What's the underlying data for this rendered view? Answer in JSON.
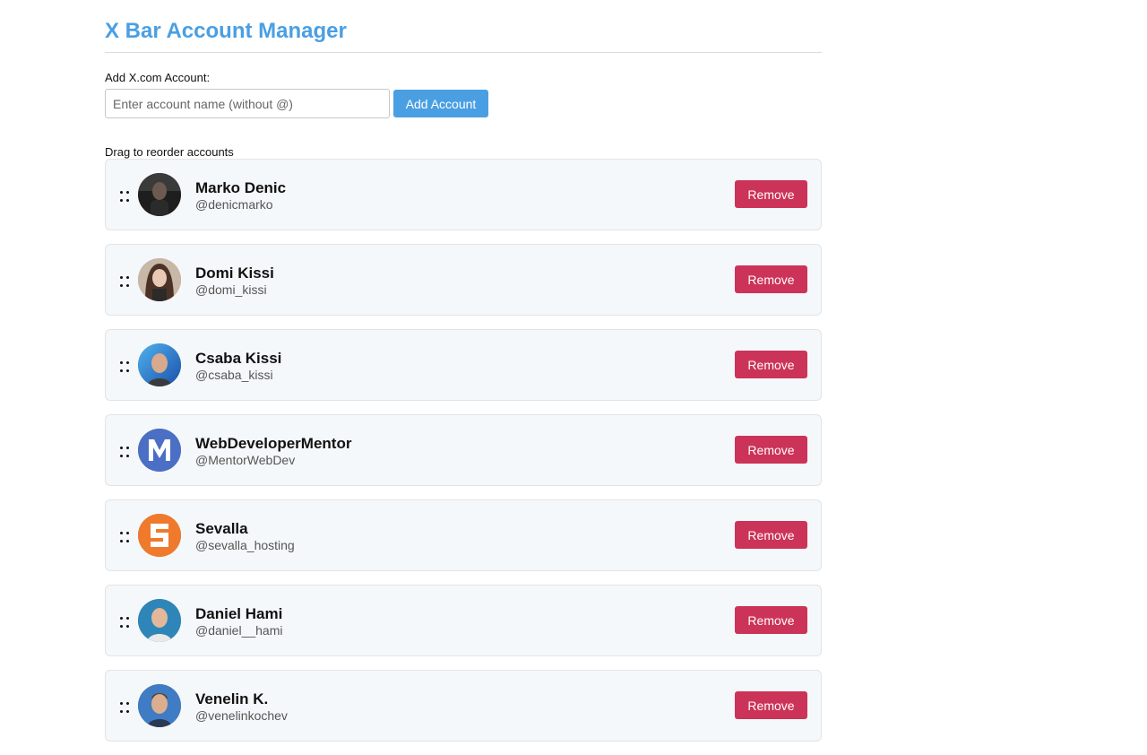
{
  "header": {
    "title": "X Bar Account Manager"
  },
  "add_form": {
    "label": "Add X.com Account:",
    "placeholder": "Enter account name (without @)",
    "value": "",
    "button_label": "Add Account"
  },
  "list_hint": "Drag to reorder accounts",
  "accounts": [
    {
      "name": "Marko Denic",
      "handle": "@denicmarko",
      "remove_label": "Remove",
      "avatar": "photo-dark"
    },
    {
      "name": "Domi Kissi",
      "handle": "@domi_kissi",
      "remove_label": "Remove",
      "avatar": "photo-woman"
    },
    {
      "name": "Csaba Kissi",
      "handle": "@csaba_kissi",
      "remove_label": "Remove",
      "avatar": "photo-blue-bg"
    },
    {
      "name": "WebDeveloperMentor",
      "handle": "@MentorWebDev",
      "remove_label": "Remove",
      "avatar": "letter-m-logo"
    },
    {
      "name": "Sevalla",
      "handle": "@sevalla_hosting",
      "remove_label": "Remove",
      "avatar": "sevalla-logo"
    },
    {
      "name": "Daniel Hami",
      "handle": "@daniel__hami",
      "remove_label": "Remove",
      "avatar": "photo-teal-bg"
    },
    {
      "name": "Venelin K.",
      "handle": "@venelinkochev",
      "remove_label": "Remove",
      "avatar": "photo-blue-bg-2"
    }
  ],
  "colors": {
    "accent": "#4a9fe3",
    "remove": "#cc3358",
    "card_bg": "#f5f8fa"
  }
}
